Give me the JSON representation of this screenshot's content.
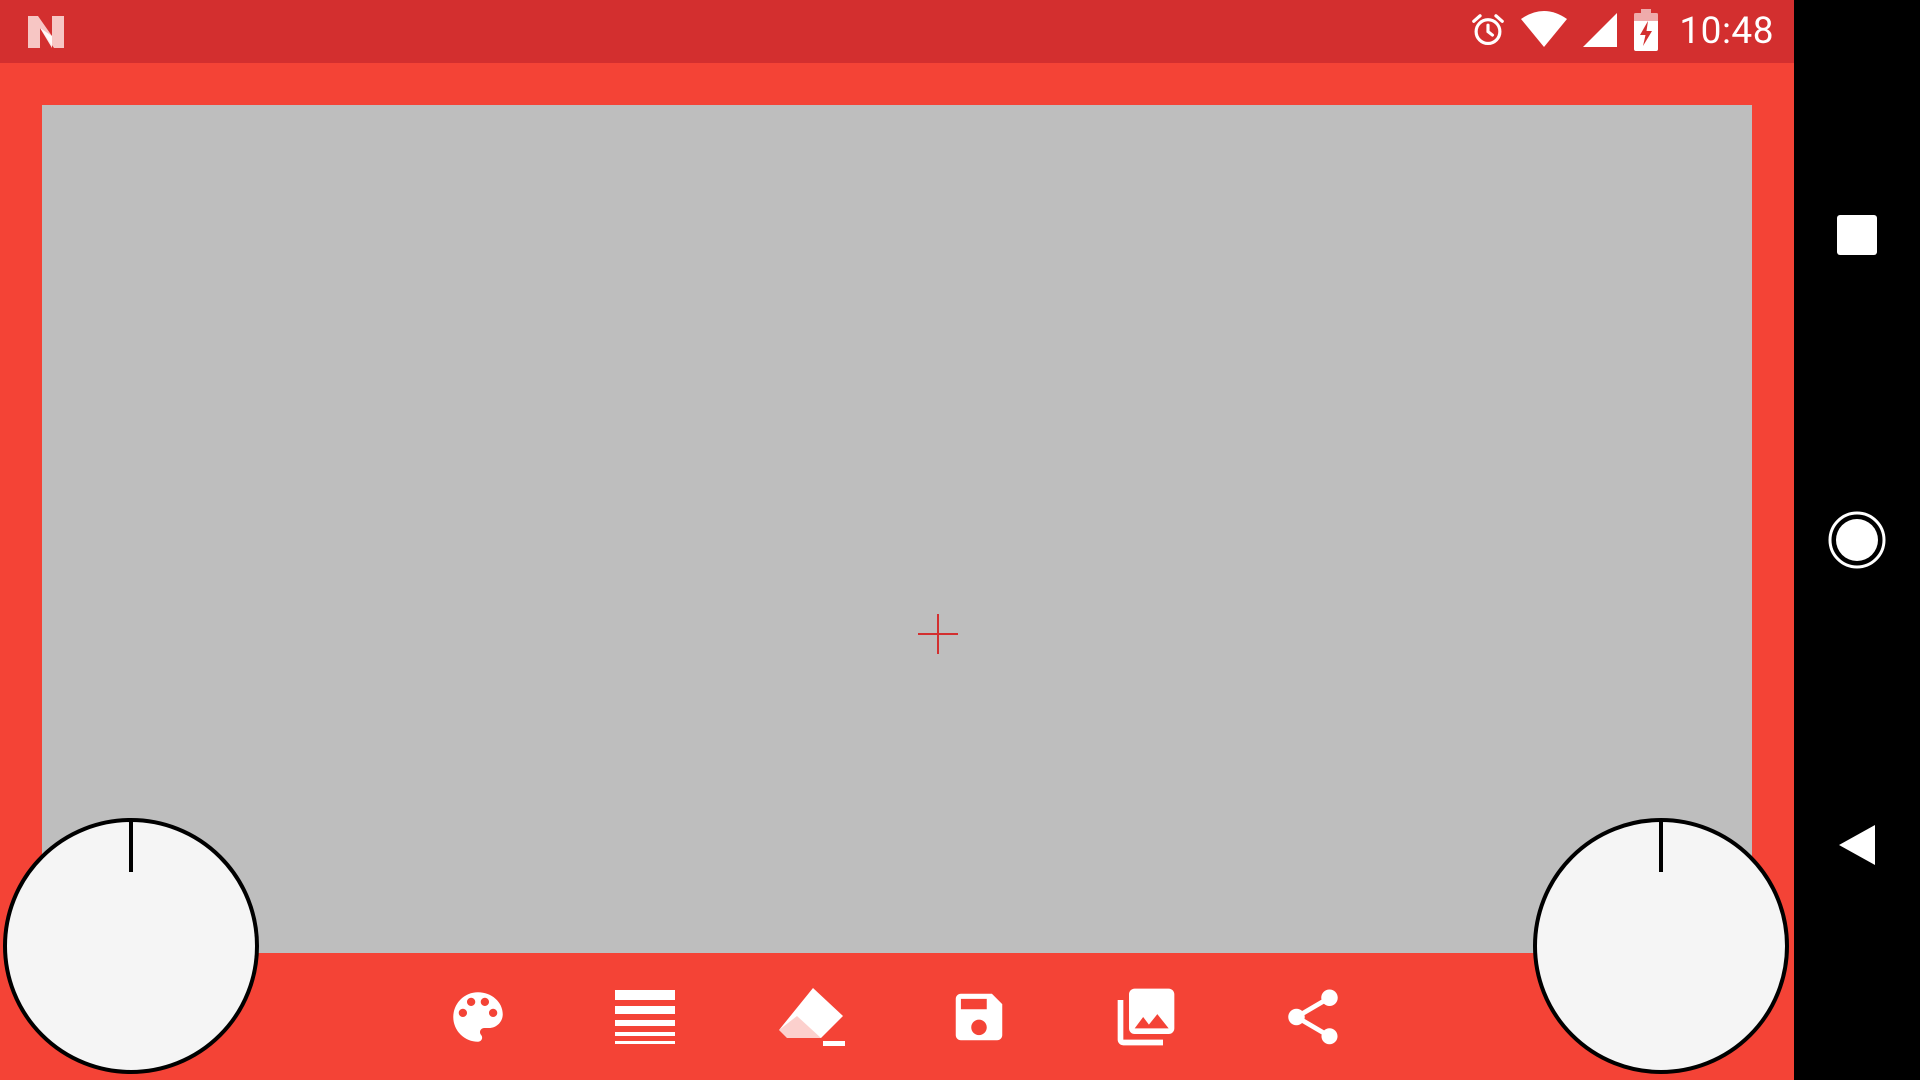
{
  "status_bar": {
    "time": "10:48",
    "left_icon": "n-notification-icon",
    "right_icons": [
      "alarm-icon",
      "wifi-icon",
      "cell-signal-icon",
      "battery-charging-icon"
    ]
  },
  "canvas": {
    "cursor_icon": "crosshair-icon"
  },
  "toolbar": {
    "tools": [
      {
        "name": "palette-button",
        "icon": "palette-icon"
      },
      {
        "name": "line-width-button",
        "icon": "line-weight-icon"
      },
      {
        "name": "erase-button",
        "icon": "eraser-icon"
      },
      {
        "name": "save-button",
        "icon": "floppy-disk-icon"
      },
      {
        "name": "gallery-button",
        "icon": "photo-library-icon"
      },
      {
        "name": "share-button",
        "icon": "share-icon"
      }
    ]
  },
  "knobs": {
    "left": {
      "rotation_deg": 0
    },
    "right": {
      "rotation_deg": 0
    }
  },
  "navigation_bar": {
    "buttons": [
      "recents-square-icon",
      "home-circle-icon",
      "back-triangle-icon"
    ]
  },
  "colors": {
    "app_red": "#f44336",
    "status_bar_red": "#d32f2f",
    "canvas_gray": "#bebebe",
    "knob_fill": "#f5f5f5",
    "crosshair_red": "#d32f2f"
  }
}
